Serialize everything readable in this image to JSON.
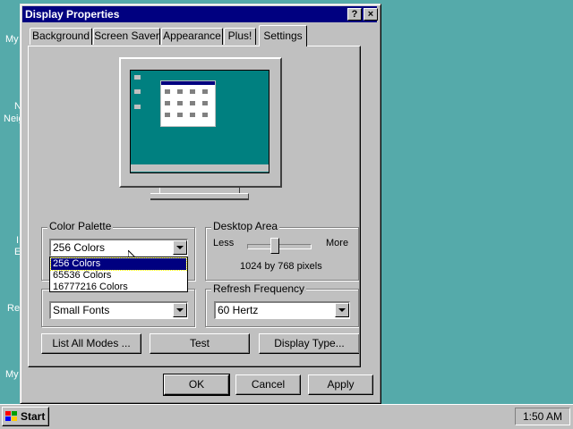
{
  "desktop": {
    "fragments": [
      {
        "text": "My",
        "key": "my1"
      },
      {
        "text": "N",
        "key": "n"
      },
      {
        "text": "Neig",
        "key": "neig"
      },
      {
        "text": "I",
        "key": "i"
      },
      {
        "text": "E",
        "key": "e"
      },
      {
        "text": "Re",
        "key": "re"
      },
      {
        "text": "My",
        "key": "my2"
      }
    ],
    "background_color": "#55aaaa"
  },
  "window": {
    "title": "Display Properties",
    "help_label": "?",
    "close_label": "×"
  },
  "tabs": [
    {
      "label": "Background"
    },
    {
      "label": "Screen Saver"
    },
    {
      "label": "Appearance"
    },
    {
      "label": "Plus!"
    },
    {
      "label": "Settings"
    }
  ],
  "color_palette": {
    "label": "Color Palette",
    "value": "256 Colors",
    "options": [
      "256 Colors",
      "65536 Colors",
      "16777216 Colors"
    ],
    "selected_index": 0
  },
  "desktop_area": {
    "label": "Desktop Area",
    "less_label": "Less",
    "more_label": "More",
    "resolution": "1024 by 768 pixels"
  },
  "font_size": {
    "value": "Small Fonts"
  },
  "refresh_frequency": {
    "label": "Refresh Frequency",
    "value": "60 Hertz"
  },
  "buttons": {
    "list_all_modes": "List All Modes ...",
    "test": "Test",
    "display_type": "Display Type...",
    "ok": "OK",
    "cancel": "Cancel",
    "apply": "Apply"
  },
  "taskbar": {
    "start_label": "Start",
    "clock": "1:50 AM"
  },
  "colors": {
    "title_bar": "#000080",
    "face": "#c0c0c0",
    "preview_screen": "#008080"
  }
}
